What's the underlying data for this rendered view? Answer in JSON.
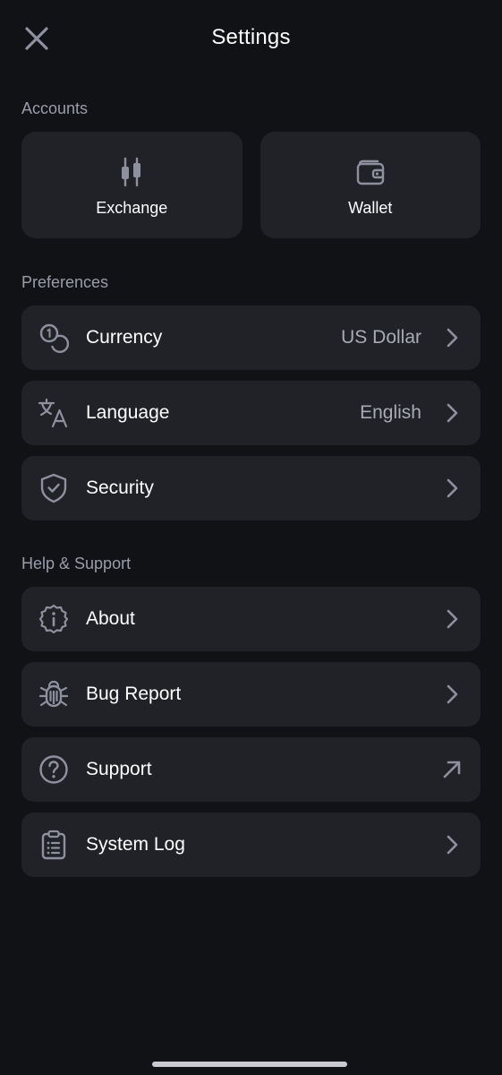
{
  "header": {
    "title": "Settings",
    "close_icon": "close-icon"
  },
  "sections": {
    "accounts": {
      "title": "Accounts",
      "cards": [
        {
          "label": "Exchange",
          "icon": "candlestick-icon"
        },
        {
          "label": "Wallet",
          "icon": "wallet-icon"
        }
      ]
    },
    "preferences": {
      "title": "Preferences",
      "items": [
        {
          "label": "Currency",
          "value": "US Dollar",
          "icon": "coins-icon",
          "trail": "chevron-right-icon"
        },
        {
          "label": "Language",
          "value": "English",
          "icon": "translate-icon",
          "trail": "chevron-right-icon"
        },
        {
          "label": "Security",
          "value": "",
          "icon": "shield-check-icon",
          "trail": "chevron-right-icon"
        }
      ]
    },
    "help": {
      "title": "Help & Support",
      "items": [
        {
          "label": "About",
          "icon": "info-badge-icon",
          "trail": "chevron-right-icon"
        },
        {
          "label": "Bug Report",
          "icon": "bug-icon",
          "trail": "chevron-right-icon"
        },
        {
          "label": "Support",
          "icon": "help-circle-icon",
          "trail": "arrow-up-right-icon"
        },
        {
          "label": "System Log",
          "icon": "clipboard-list-icon",
          "trail": "chevron-right-icon"
        }
      ]
    }
  },
  "colors": {
    "background": "#111216",
    "card": "#212227",
    "icon": "#8e90a0",
    "muted_text": "#9a9cab",
    "value_text": "#a8aab6"
  }
}
